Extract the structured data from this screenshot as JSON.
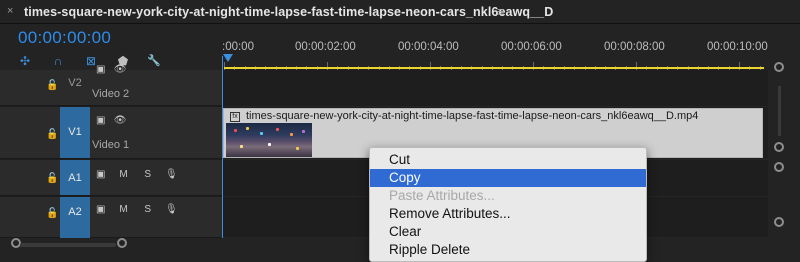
{
  "tab": {
    "title": "times-square-new-york-city-at-night-time-lapse-fast-time-lapse-neon-cars_nkl6eawq__D",
    "close_glyph": "×",
    "menu_glyph": "≡"
  },
  "timecode": "00:00:00:00",
  "tools": [
    {
      "name": "snap-icon",
      "glyph": "✣",
      "color": "#3b8fdc"
    },
    {
      "name": "linked-selection-icon",
      "glyph": "∩",
      "color": "#3b8fdc"
    },
    {
      "name": "add-marker-icon",
      "glyph": "⊠",
      "color": "#3b8fdc"
    },
    {
      "name": "marker-icon",
      "glyph": "⬟",
      "color": "#bdbdbd"
    },
    {
      "name": "wrench-icon",
      "glyph": "🔧",
      "color": "#bdbdbd"
    }
  ],
  "ruler": {
    "labels": [
      ":00:00",
      "00:00:02:00",
      "00:00:04:00",
      "00:00:06:00",
      "00:00:08:00",
      "00:00:10:00"
    ]
  },
  "tracks": [
    {
      "id": "V2",
      "name": "Video 2",
      "icons": [
        "film",
        "eye"
      ],
      "active": false
    },
    {
      "id": "V1",
      "name": "Video 1",
      "icons": [
        "film",
        "eye"
      ],
      "active": true
    },
    {
      "id": "A1",
      "name": "",
      "icons": [
        "film",
        "M",
        "S",
        "mic"
      ],
      "active": true
    },
    {
      "id": "A2",
      "name": "",
      "icons": [
        "film",
        "M",
        "S",
        "mic"
      ],
      "active": true
    }
  ],
  "clip": {
    "name": "times-square-new-york-city-at-night-time-lapse-fast-time-lapse-neon-cars_nkl6eawq__D.mp4",
    "fx_badge": "fx"
  },
  "context_menu": {
    "items": [
      {
        "label": "Cut",
        "state": "normal"
      },
      {
        "label": "Copy",
        "state": "highlighted"
      },
      {
        "label": "Paste Attributes...",
        "state": "disabled"
      },
      {
        "label": "Remove Attributes...",
        "state": "normal"
      },
      {
        "label": "Clear",
        "state": "normal"
      },
      {
        "label": "Ripple Delete",
        "state": "normal"
      }
    ]
  },
  "colors": {
    "accent": "#3b8fdc",
    "track_active": "#2c6aa0",
    "inout_bar": "#e8d72a",
    "menu_highlight": "#2f6bd3"
  }
}
